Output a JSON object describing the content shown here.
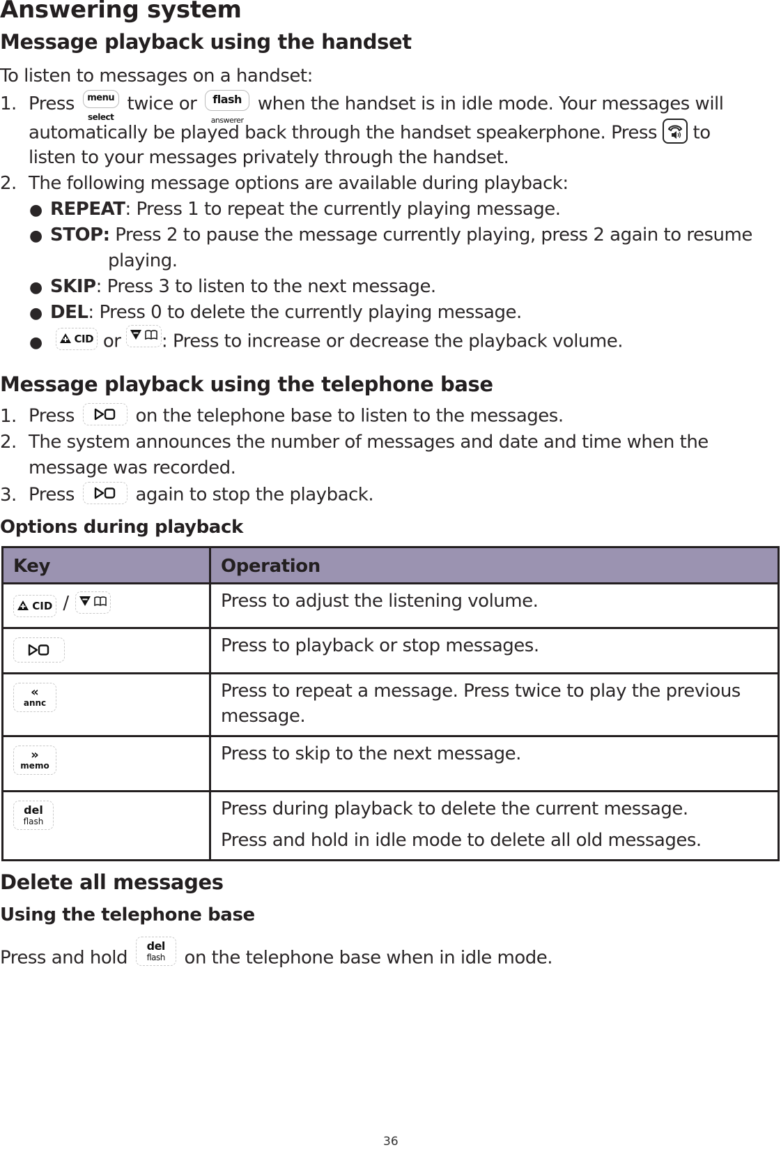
{
  "page": {
    "title": "Answering system",
    "page_number": "36"
  },
  "handset_section": {
    "heading": "Message playback using the handset",
    "intro": "To listen to messages on a handset:",
    "step1": {
      "num": "1.",
      "press": "Press",
      "key1": {
        "top": "menu",
        "bottom": "select"
      },
      "twice_or": "twice or",
      "key2": {
        "top": "flash",
        "bottom": "answerer"
      },
      "rest_line1": "when the handset is in idle mode. Your messages will",
      "line2_a": "automatically be played back through the handset speakerphone. Press",
      "speaker_icon": "speakerphone-icon",
      "line2_b": "to",
      "line3": "listen to your messages privately through the handset."
    },
    "step2": {
      "num": "2.",
      "text": "The following message options are available during playback:"
    },
    "options": [
      {
        "label": "REPEAT",
        "text": ": Press 1 to repeat the currently playing message."
      },
      {
        "label": "STOP:",
        "text": " Press 2 to pause the message currently playing, press 2 again to resume",
        "continuation": "playing."
      },
      {
        "label": "SKIP",
        "text": ": Press 3 to listen to the next message."
      },
      {
        "label": "DEL",
        "text": ": Press 0 to delete the currently playing message."
      }
    ],
    "volume_option": {
      "key_up_label": "CID",
      "key_up_icon": "volume-up-triangle-icon",
      "or": "or",
      "key_down_icon": "volume-down-triangle-icon",
      "key_down_book_icon": "phonebook-icon",
      "text": ": Press to increase or decrease the playback volume."
    }
  },
  "base_section": {
    "heading": "Message playback using the telephone base",
    "steps": [
      {
        "num": "1.",
        "before": "Press",
        "key_icon": "play-stop-icon",
        "after": "on the telephone base to listen to the messages."
      },
      {
        "num": "2.",
        "text": "The system announces the number of messages and date and time when the",
        "continuation": "message was recorded."
      },
      {
        "num": "3.",
        "before": "Press",
        "key_icon": "play-stop-icon",
        "after": "again to stop the playback."
      }
    ]
  },
  "options_table": {
    "heading": "Options during playback",
    "columns": [
      "Key",
      "Operation"
    ],
    "header_color": "#9b93b1",
    "rows": [
      {
        "key": {
          "type": "volume",
          "up_label": "CID",
          "separator": "/"
        },
        "operation": [
          "Press to adjust the listening volume."
        ]
      },
      {
        "key": {
          "type": "play-stop"
        },
        "operation": [
          "Press to playback or stop messages."
        ]
      },
      {
        "key": {
          "type": "repeat",
          "glyph": "«",
          "label": "annc"
        },
        "operation": [
          "Press to repeat a message. Press twice to play the previous message."
        ]
      },
      {
        "key": {
          "type": "skip",
          "glyph": "»",
          "label": "memo"
        },
        "operation": [
          "Press to skip to the next message."
        ]
      },
      {
        "key": {
          "type": "delete",
          "top": "del",
          "bottom": "flash"
        },
        "operation": [
          "Press during playback to delete the current message.",
          "Press and hold in idle mode to delete all old messages."
        ]
      }
    ]
  },
  "delete_section": {
    "heading": "Delete all messages",
    "subheading": "Using the telephone base",
    "before": "Press and hold",
    "key": {
      "top": "del",
      "bottom": "flash"
    },
    "after": "on the telephone base when in idle mode."
  }
}
